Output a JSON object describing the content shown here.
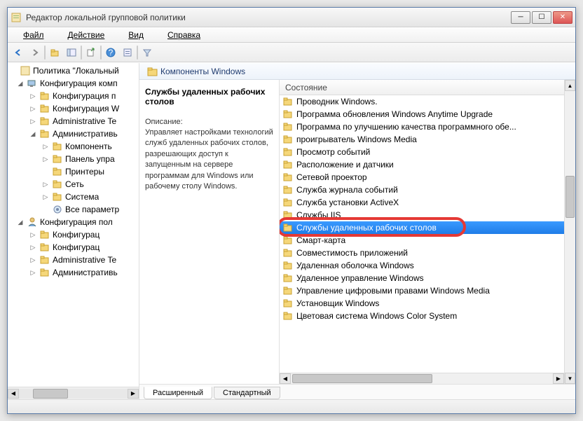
{
  "window": {
    "title": "Редактор локальной групповой политики"
  },
  "menu": {
    "file": "Файл",
    "action": "Действие",
    "view": "Вид",
    "help": "Справка"
  },
  "tree": {
    "root": "Политика \"Локальный",
    "comp_config": "Конфигурация комп",
    "sw1": "Конфигурация п",
    "sw2": "Конфигурация W",
    "admin": "Administrative Te",
    "admin2": "Административь",
    "components": "Компоненть",
    "panel": "Панель упра",
    "printers": "Принтеры",
    "network": "Сеть",
    "system": "Система",
    "allsettings": "Все параметр",
    "user_config": "Конфигурация пол",
    "sw3": "Конфигурац",
    "sw4": "Конфигурац",
    "admin3": "Administrative Te",
    "admin4": "Административь"
  },
  "crumb": "Компоненты Windows",
  "desc": {
    "title": "Службы удаленных рабочих столов",
    "label": "Описание:",
    "text": "Управляет настройками технологий служб удаленных рабочих столов, разрешающих доступ к запущенным на сервере программам для Windows или рабочему столу Windows."
  },
  "list": {
    "header": "Состояние",
    "items": [
      "Проводник Windows.",
      "Программа обновления Windows Anytime Upgrade",
      "Программа по улучшению качества программного обе...",
      "проигрыватель Windows Media",
      "Просмотр событий",
      "Расположение и датчики",
      "Сетевой проектор",
      "Служба журнала событий",
      "Служба установки ActiveX",
      "Службы IIS",
      "Службы удаленных рабочих столов",
      "Смарт-карта",
      "Совместимость приложений",
      "Удаленная оболочка Windows",
      "Удаленное управление Windows",
      "Управление цифровыми правами Windows Media",
      "Установщик Windows",
      "Цветовая система Windows Color System"
    ],
    "selected_index": 10
  },
  "tabs": {
    "extended": "Расширенный",
    "standard": "Стандартный"
  }
}
